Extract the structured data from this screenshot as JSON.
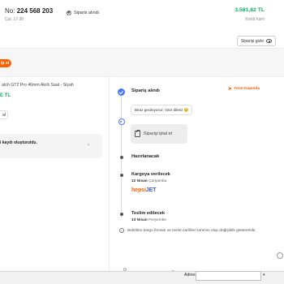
{
  "header": {
    "order_prefix": "No:",
    "order_number": "224 568 203",
    "order_date": "Çar, 17:38",
    "status_label": "Siparis alındı",
    "total": "3.581,82 TL",
    "payment_method": "Kredi Kartı",
    "details_button": "Siparişi gizle"
  },
  "banner": {
    "tag_label": "ip et"
  },
  "product": {
    "name": "atch GT2 Pro 46mm Akıllı Saat - Siyah",
    "price": "E TL",
    "chip_label": "al",
    "record_text": "i kaydı oluşturuldu.",
    "record_chevron": "›"
  },
  "timeline": {
    "fast_badge": "Yarın Kapında",
    "steps": [
      {
        "title": "Sipariş alındı",
        "date_bold": "",
        "date_rest": ""
      },
      {
        "title": "Hazırlanacak",
        "date_bold": "",
        "date_rest": ""
      },
      {
        "title": "Kargoya verilecek",
        "date_bold": "12 Nisan",
        "date_rest": "Çarşamba"
      },
      {
        "title": "Teslim edilecek",
        "date_bold": "13 Nisan",
        "date_rest": "Perşembe"
      }
    ],
    "chat_message": "Biraz gecikiyoruz, özür dileriz 😊",
    "cancel_button": "Siparişi iptal et",
    "carrier_part1": "hepsi",
    "carrier_part2": "JET",
    "info_icon_char": "i",
    "info_text": "Belirtilen kargo firması ve teslim tarihleri tahmini olup değişiklik gösterebilir."
  },
  "bottom_bar": {
    "address_label": "Adres",
    "address_value": "",
    "dropdown_char": "▾"
  },
  "colors": {
    "accent_blue": "#4a78f5",
    "brand_orange": "#ff6000",
    "price_green": "#0bb15a"
  }
}
